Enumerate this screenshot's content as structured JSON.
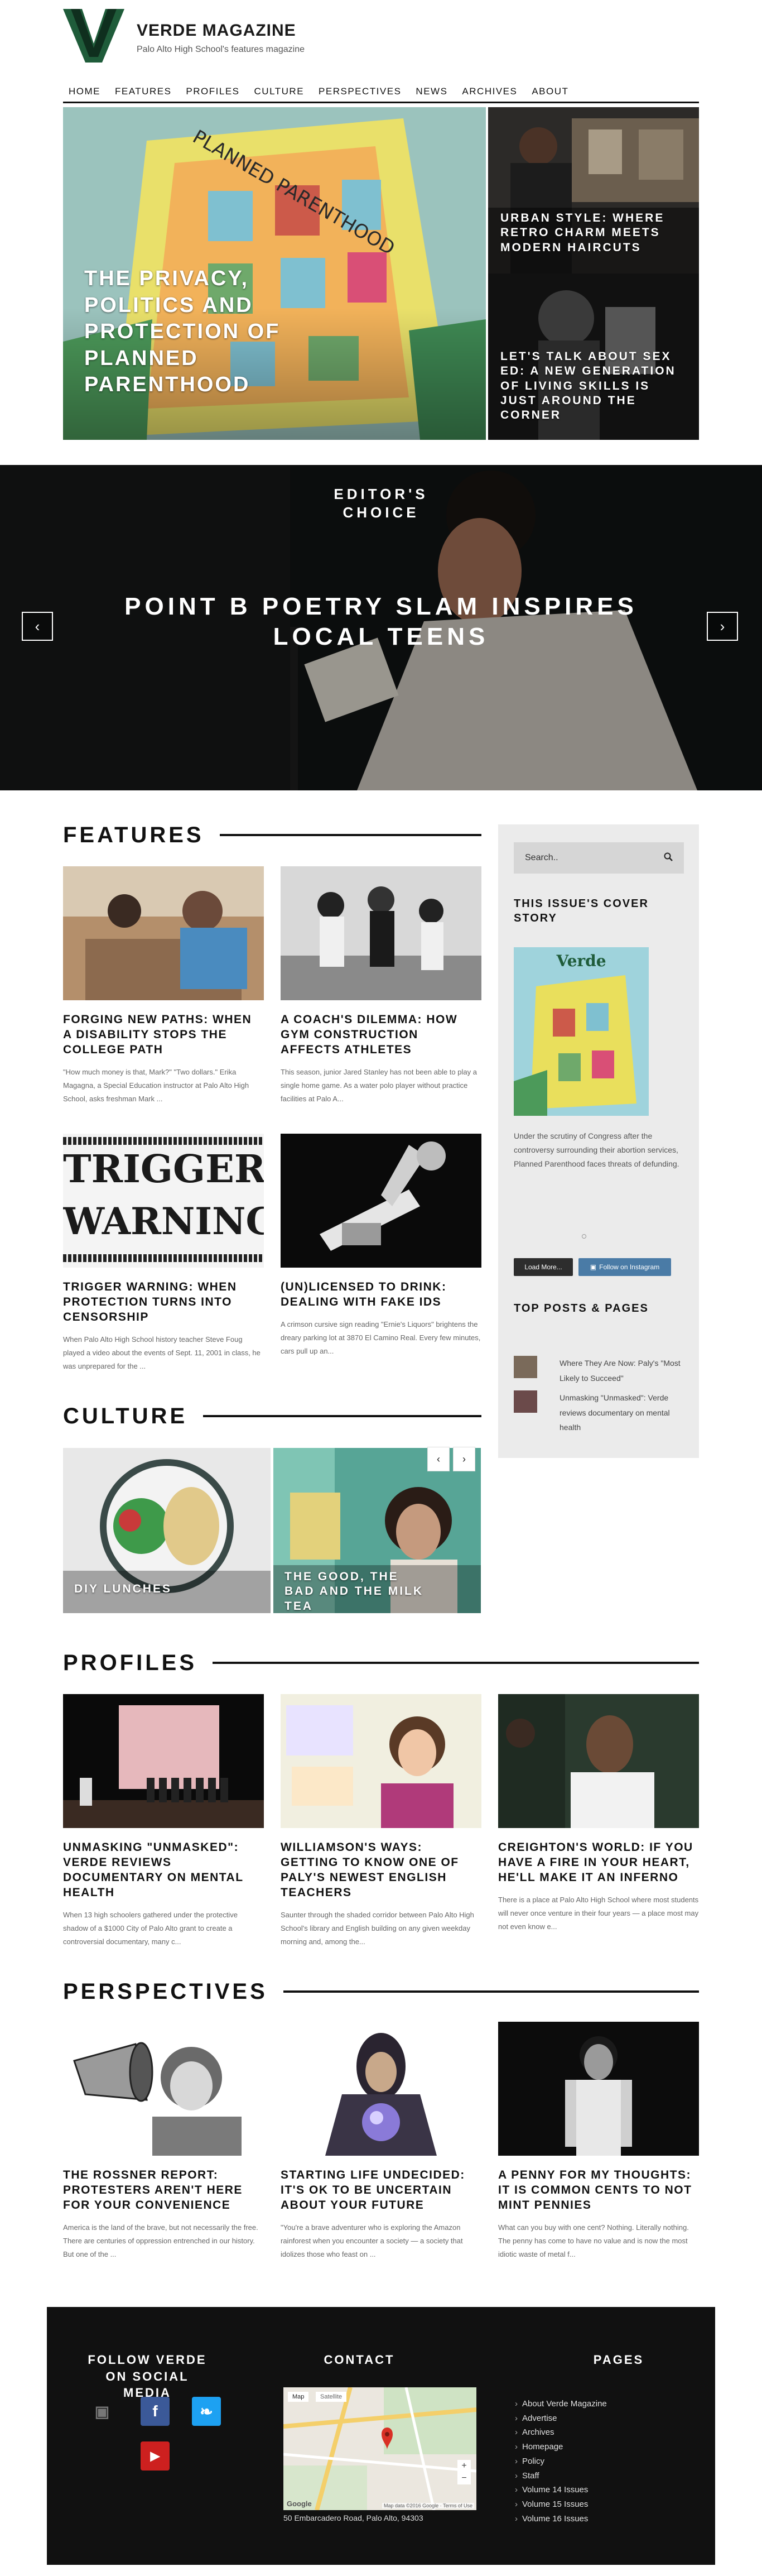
{
  "header": {
    "title": "VERDE MAGAZINE",
    "subtitle": "Palo Alto High School's features magazine",
    "logo_letter": "V",
    "brand_color": "#1f5c3a",
    "nav": [
      "HOME",
      "FEATURES",
      "PROFILES",
      "CULTURE",
      "PERSPECTIVES",
      "NEWS",
      "ARCHIVES",
      "ABOUT"
    ]
  },
  "top_stories": {
    "main": "THE PRIVACY, POLITICS AND PROTECTION OF PLANNED PARENTHOOD",
    "main_sign_text": "PLANNED PARENTHOOD",
    "side_1": "URBAN STYLE: WHERE RETRO CHARM MEETS MODERN HAIRCUTS",
    "side_2": "LET'S TALK ABOUT SEX ED: A NEW GENERATION OF LIVING SKILLS IS JUST AROUND THE CORNER"
  },
  "editors_choice": {
    "kicker": "EDITOR'S CHOICE",
    "title": "POINT B POETRY SLAM INSPIRES LOCAL TEENS",
    "prev_icon": "chevron-left-icon",
    "next_icon": "chevron-right-icon"
  },
  "features": {
    "heading": "FEATURES",
    "articles": [
      {
        "title": "FORGING NEW PATHS: WHEN A DISABILITY STOPS THE COLLEGE PATH",
        "excerpt": "\"How much money is that, Mark?\" \"Two dollars.\" Erika Magagna, a Special Education instructor at Palo Alto High School, asks freshman Mark ..."
      },
      {
        "title": "A COACH'S DILEMMA: HOW GYM CONSTRUCTION AFFECTS ATHLETES",
        "excerpt": "This season, junior Jared Stanley has not been able to play a single home game. As a water polo player without practice facilities at Palo A..."
      },
      {
        "title": "TRIGGER WARNING: WHEN PROTECTION TURNS INTO CENSORSHIP",
        "excerpt": "When Palo Alto High School history teacher Steve Foug played a video about the events of Sept. 11, 2001 in class, he was unprepared for the ...",
        "image_text_1": "TRIGGER",
        "image_text_2": "WARNING"
      },
      {
        "title": "(UN)LICENSED TO DRINK: DEALING WITH FAKE IDS",
        "excerpt": "A crimson cursive sign reading \"Ernie's Liquors\" brightens the dreary parking lot at 3870 El Camino Real. Every few minutes, cars pull up an..."
      }
    ]
  },
  "sidebar": {
    "search_placeholder": "Search..",
    "search_icon": "search-icon",
    "cover_heading": "THIS ISSUE'S COVER STORY",
    "cover_caption": "Under the scrutiny of Congress after the controversy surrounding their abortion services, Planned Parenthood faces threats of defunding.",
    "cover_logo": "Verde",
    "load_more": "Load More...",
    "follow_instagram": "Follow on Instagram",
    "top_heading": "TOP POSTS & PAGES",
    "top_posts": [
      "Where They Are Now: Paly's \"Most Likely to Succeed\"",
      "Unmasking \"Unmasked\": Verde reviews documentary on mental health"
    ]
  },
  "culture": {
    "heading": "CULTURE",
    "items": [
      "DIY LUNCHES",
      "THE GOOD, THE BAD AND THE MILK TEA"
    ],
    "prev": "‹",
    "next": "›"
  },
  "profiles": {
    "heading": "PROFILES",
    "articles": [
      {
        "title": "UNMASKING \"UNMASKED\": VERDE REVIEWS DOCUMENTARY ON MENTAL HEALTH",
        "excerpt": "When 13 high schoolers gathered under the protective shadow of a $1000 City of Palo Alto grant to create a controversial documentary, many c..."
      },
      {
        "title": "WILLIAMSON'S WAYS: GETTING TO KNOW ONE OF PALY'S NEWEST ENGLISH TEACHERS",
        "excerpt": "Saunter through the shaded corridor between Palo Alto High School's library and English building on any given weekday morning and, among the..."
      },
      {
        "title": "CREIGHTON'S WORLD: IF YOU HAVE A FIRE IN YOUR HEART, HE'LL MAKE IT AN INFERNO",
        "excerpt": "There is a place at Palo Alto High School where most students will never once venture in their four years — a place most may not even know e..."
      }
    ]
  },
  "perspectives": {
    "heading": "PERSPECTIVES",
    "articles": [
      {
        "title": "THE ROSSNER REPORT: PROTESTERS AREN'T HERE FOR YOUR CONVENIENCE",
        "excerpt": "America is the land of the brave, but not necessarily the free. There are centuries of oppression entrenched in our history. But one of the ..."
      },
      {
        "title": "STARTING LIFE UNDECIDED: IT'S OK TO BE UNCERTAIN ABOUT YOUR FUTURE",
        "excerpt": "\"You're a brave adventurer who is exploring the Amazon rainforest when you encounter a society — a society that idolizes those who feast on ..."
      },
      {
        "title": "A PENNY FOR MY THOUGHTS: IT IS COMMON CENTS TO NOT MINT PENNIES",
        "excerpt": "What can you buy with one cent? Nothing. Literally nothing. The penny has come to have no value and is now the most idiotic waste of metal f..."
      }
    ]
  },
  "footer": {
    "social_heading": "FOLLOW VERDE ON SOCIAL MEDIA",
    "contact_heading": "CONTACT",
    "pages_heading": "PAGES",
    "address": "50 Embarcadero Road, Palo Alto, 94303",
    "map_tab_map": "Map",
    "map_tab_sat": "Satellite",
    "map_google": "Google",
    "map_footer": "Map data ©2016 Google · Terms of Use",
    "map_zoom_in": "+",
    "map_zoom_out": "−",
    "social": [
      {
        "icon": "instagram-icon",
        "color": "#2b2b2b",
        "glyph": "▣"
      },
      {
        "icon": "facebook-icon",
        "color": "#3b5998",
        "glyph": "f"
      },
      {
        "icon": "twitter-icon",
        "color": "#1da1f2",
        "glyph": "❧"
      },
      {
        "icon": "youtube-icon",
        "color": "#cd201f",
        "glyph": "▶"
      }
    ],
    "pages": [
      "About Verde Magazine",
      "Advertise",
      "Archives",
      "Homepage",
      "Policy",
      "Staff",
      "Volume 14 Issues",
      "Volume 15 Issues",
      "Volume 16 Issues"
    ]
  }
}
